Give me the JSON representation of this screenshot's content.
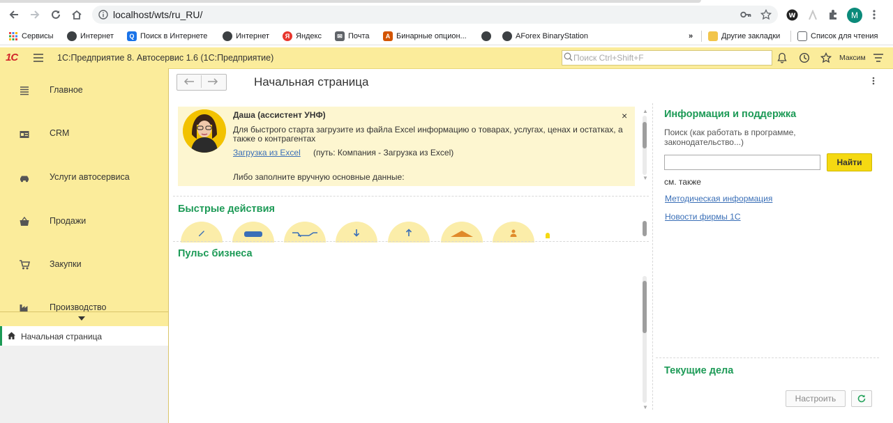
{
  "browser": {
    "url": "localhost/wts/ru_RU/",
    "profile_initial": "M",
    "bookmarks": [
      {
        "label": "Сервисы",
        "icon": "apps-grid-icon"
      },
      {
        "label": "Интернет",
        "icon": "globe-icon"
      },
      {
        "label": "Поиск в Интернете",
        "icon": "search-icon"
      },
      {
        "label": "Интернет",
        "icon": "globe-icon"
      },
      {
        "label": "Яндекс",
        "icon": "yandex-icon"
      },
      {
        "label": "Почта",
        "icon": "mail-icon"
      },
      {
        "label": "Бинарные опцион...",
        "icon": "binary-icon"
      },
      {
        "label": "AForex BinaryStation",
        "icon": "globe-icon"
      }
    ],
    "other_bookmarks": "Другие закладки",
    "reading_list": "Список для чтения",
    "overflow": "»"
  },
  "app": {
    "logo": "1С",
    "title": "1С:Предприятие 8. Автосервис 1.6  (1С:Предприятие)",
    "search_placeholder": "Поиск Ctrl+Shift+F",
    "username": "Максим",
    "accent": "#1c9a56",
    "bar_color": "#fbec9b"
  },
  "sidebar": {
    "items": [
      {
        "label": "Главное",
        "icon": "menu-lines-icon"
      },
      {
        "label": "CRM",
        "icon": "contact-card-icon"
      },
      {
        "label": "Услуги автосервиса",
        "icon": "car-icon"
      },
      {
        "label": "Продажи",
        "icon": "basket-icon"
      },
      {
        "label": "Закупки",
        "icon": "cart-icon"
      },
      {
        "label": "Производство",
        "icon": "factory-icon"
      }
    ],
    "open_page": "Начальная страница"
  },
  "main": {
    "page_title": "Начальная страница",
    "assistant": {
      "name": "Даша (ассистент УНФ)",
      "text": "Для быстрого старта загрузите из файла Excel информацию о товарах, услугах, ценах и остатках, а также о контрагентах",
      "link": "Загрузка из Excel",
      "path": "(путь: Компания - Загрузка из Excel)",
      "manual": "Либо заполните вручную основные данные:",
      "close": "×"
    },
    "quick_actions_title": "Быстрые действия",
    "business_pulse_title": "Пульс бизнеса"
  },
  "right": {
    "info_title": "Информация и поддержка",
    "search_desc": "Поиск (как работать в программе, законодательство...)",
    "find_button": "Найти",
    "see_also": "см. также",
    "links": [
      "Методическая информация",
      "Новости фирмы 1С"
    ],
    "tasks_title": "Текущие дела",
    "tune_button": "Настроить"
  }
}
